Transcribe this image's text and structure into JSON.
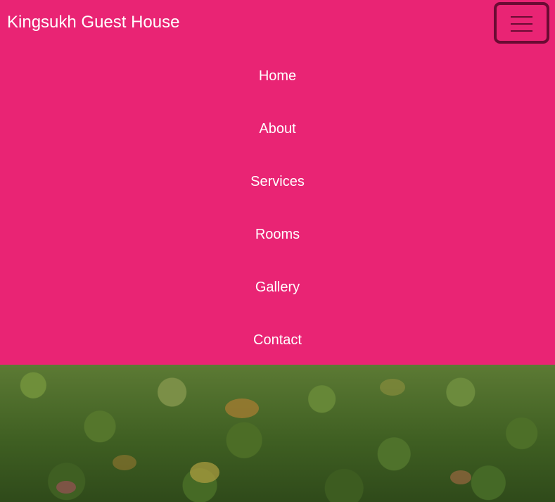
{
  "navbar": {
    "brand": "Kingsukh Guest House",
    "toggle_icon": "hamburger-menu-icon",
    "background_color": "#e92474",
    "items": [
      {
        "label": "Home"
      },
      {
        "label": "About"
      },
      {
        "label": "Services"
      },
      {
        "label": "Rooms"
      },
      {
        "label": "Gallery"
      },
      {
        "label": "Contact"
      }
    ]
  },
  "hero": {
    "image_subject": "forest-treetops"
  }
}
